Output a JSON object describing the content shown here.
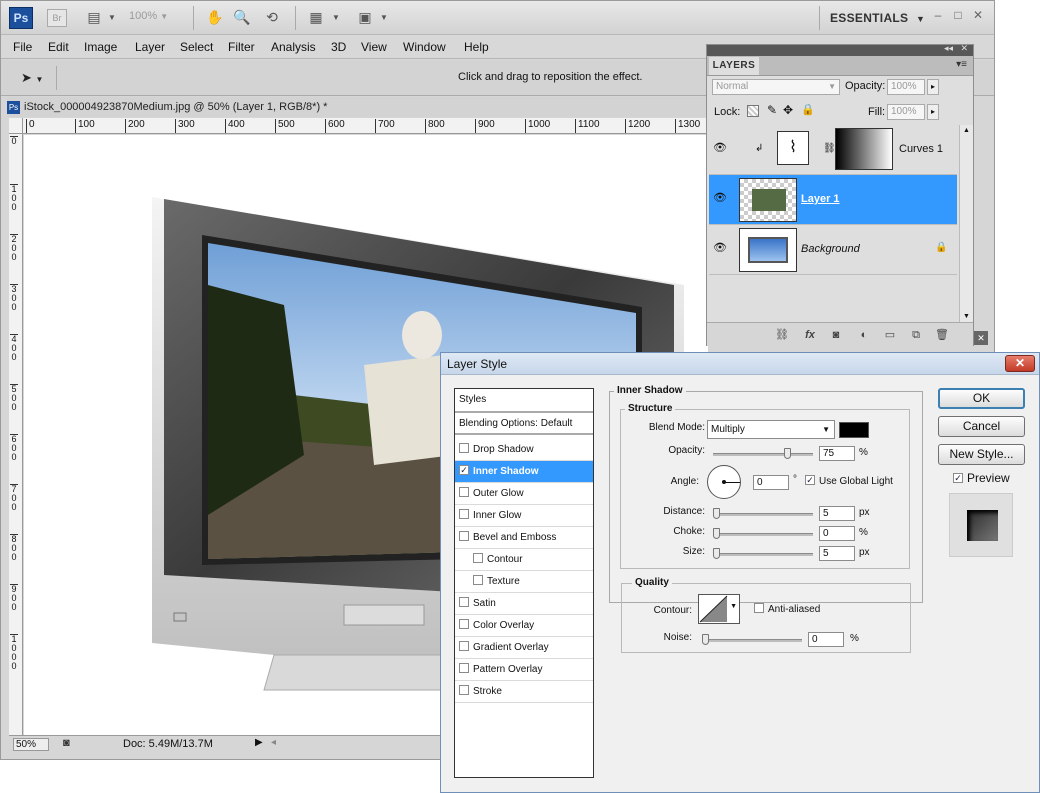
{
  "app": {
    "logo": "Ps",
    "bridge": "Br",
    "zoom": "100%",
    "workspace": "ESSENTIALS",
    "workspace_arrow": "▼",
    "win_min": "–",
    "win_max": "□",
    "win_close": "✕"
  },
  "menu": [
    "File",
    "Edit",
    "Image",
    "Layer",
    "Select",
    "Filter",
    "Analysis",
    "3D",
    "View",
    "Window",
    "Help"
  ],
  "options_bar": {
    "hint": "Click and drag to reposition the effect."
  },
  "document": {
    "tab_title": "iStock_000004923870Medium.jpg @ 50% (Layer 1, RGB/8*) *",
    "ruler_h": [
      "0",
      "100",
      "200",
      "300",
      "400",
      "500",
      "600",
      "700",
      "800",
      "900",
      "1000",
      "1100",
      "1200",
      "1300"
    ],
    "ruler_v": [
      "0",
      "1 0 0",
      "2 0 0",
      "3 0 0",
      "4 0 0",
      "5 0 0",
      "6 0 0",
      "7 0 0",
      "8 0 0",
      "9 0 0",
      "1 0 0 0"
    ],
    "zoom_status": "50%",
    "doc_status": "Doc: 5.49M/13.7M"
  },
  "layers_panel": {
    "tab": "LAYERS",
    "blend_mode": "Normal",
    "opacity_label": "Opacity:",
    "opacity_value": "100%",
    "lock_label": "Lock:",
    "fill_label": "Fill:",
    "fill_value": "100%",
    "layers": [
      {
        "name": "Curves 1",
        "selected": false
      },
      {
        "name": "Layer 1",
        "selected": true
      },
      {
        "name": "Background",
        "selected": false
      }
    ],
    "colors": {
      "selected": "#3399ff"
    }
  },
  "layer_style": {
    "title": "Layer Style",
    "close": "✕",
    "styles_header": "Styles",
    "blending_options": "Blending Options: Default",
    "effects": [
      {
        "label": "Drop Shadow",
        "checked": false,
        "selected": false,
        "indent": false
      },
      {
        "label": "Inner Shadow",
        "checked": true,
        "selected": true,
        "indent": false
      },
      {
        "label": "Outer Glow",
        "checked": false,
        "selected": false,
        "indent": false
      },
      {
        "label": "Inner Glow",
        "checked": false,
        "selected": false,
        "indent": false
      },
      {
        "label": "Bevel and Emboss",
        "checked": false,
        "selected": false,
        "indent": false
      },
      {
        "label": "Contour",
        "checked": false,
        "selected": false,
        "indent": true
      },
      {
        "label": "Texture",
        "checked": false,
        "selected": false,
        "indent": true
      },
      {
        "label": "Satin",
        "checked": false,
        "selected": false,
        "indent": false
      },
      {
        "label": "Color Overlay",
        "checked": false,
        "selected": false,
        "indent": false
      },
      {
        "label": "Gradient Overlay",
        "checked": false,
        "selected": false,
        "indent": false
      },
      {
        "label": "Pattern Overlay",
        "checked": false,
        "selected": false,
        "indent": false
      },
      {
        "label": "Stroke",
        "checked": false,
        "selected": false,
        "indent": false
      }
    ],
    "section_title": "Inner Shadow",
    "structure_title": "Structure",
    "blend_mode_label": "Blend Mode:",
    "blend_mode_value": "Multiply",
    "opacity_label": "Opacity:",
    "opacity_value": "75",
    "opacity_level": 0.75,
    "angle_label": "Angle:",
    "angle_value": "0",
    "angle_unit": "°",
    "global_light_label": "Use Global Light",
    "global_light_checked": true,
    "distance_label": "Distance:",
    "distance_value": "5",
    "choke_label": "Choke:",
    "choke_value": "0",
    "size_label": "Size:",
    "size_value": "5",
    "px": "px",
    "pct": "%",
    "quality_title": "Quality",
    "contour_label": "Contour:",
    "anti_aliased_label": "Anti-aliased",
    "noise_label": "Noise:",
    "noise_value": "0",
    "buttons": {
      "ok": "OK",
      "cancel": "Cancel",
      "new_style": "New Style...",
      "preview": "Preview"
    },
    "preview_checked": true,
    "shadow_color": "#000000"
  }
}
